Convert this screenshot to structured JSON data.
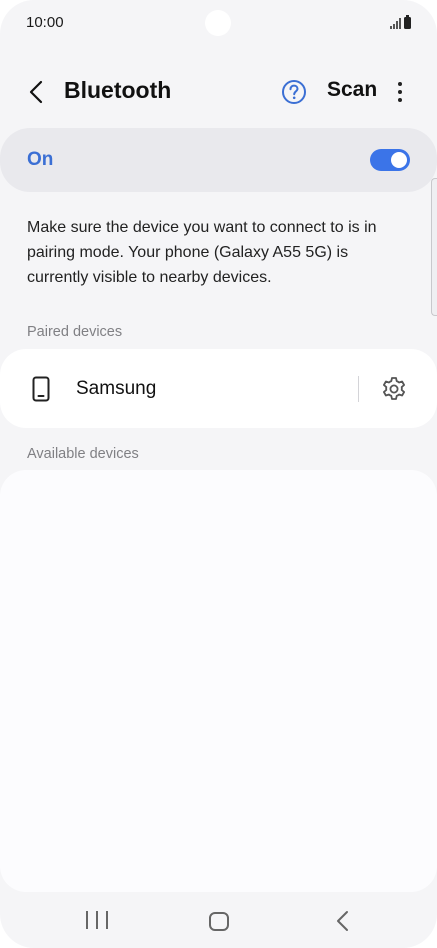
{
  "status_bar": {
    "time": "10:00"
  },
  "header": {
    "title": "Bluetooth",
    "scan_label": "Scan"
  },
  "bluetooth": {
    "state_label": "On",
    "enabled": true
  },
  "description": "Make sure the device you want to connect to is in pairing mode. Your phone (Galaxy A55 5G) is currently visible to nearby devices.",
  "paired": {
    "section_label": "Paired devices",
    "devices": [
      {
        "name": "Samsung",
        "icon": "phone-icon"
      }
    ]
  },
  "available": {
    "section_label": "Available devices",
    "devices": []
  },
  "colors": {
    "accent": "#3b74e8",
    "on_text": "#3b6fd4",
    "background": "#f5f5f7"
  },
  "icons": [
    "back-arrow-icon",
    "help-icon",
    "more-vertical-icon",
    "phone-icon",
    "gear-icon",
    "recent-apps-icon",
    "home-icon",
    "nav-back-icon"
  ]
}
